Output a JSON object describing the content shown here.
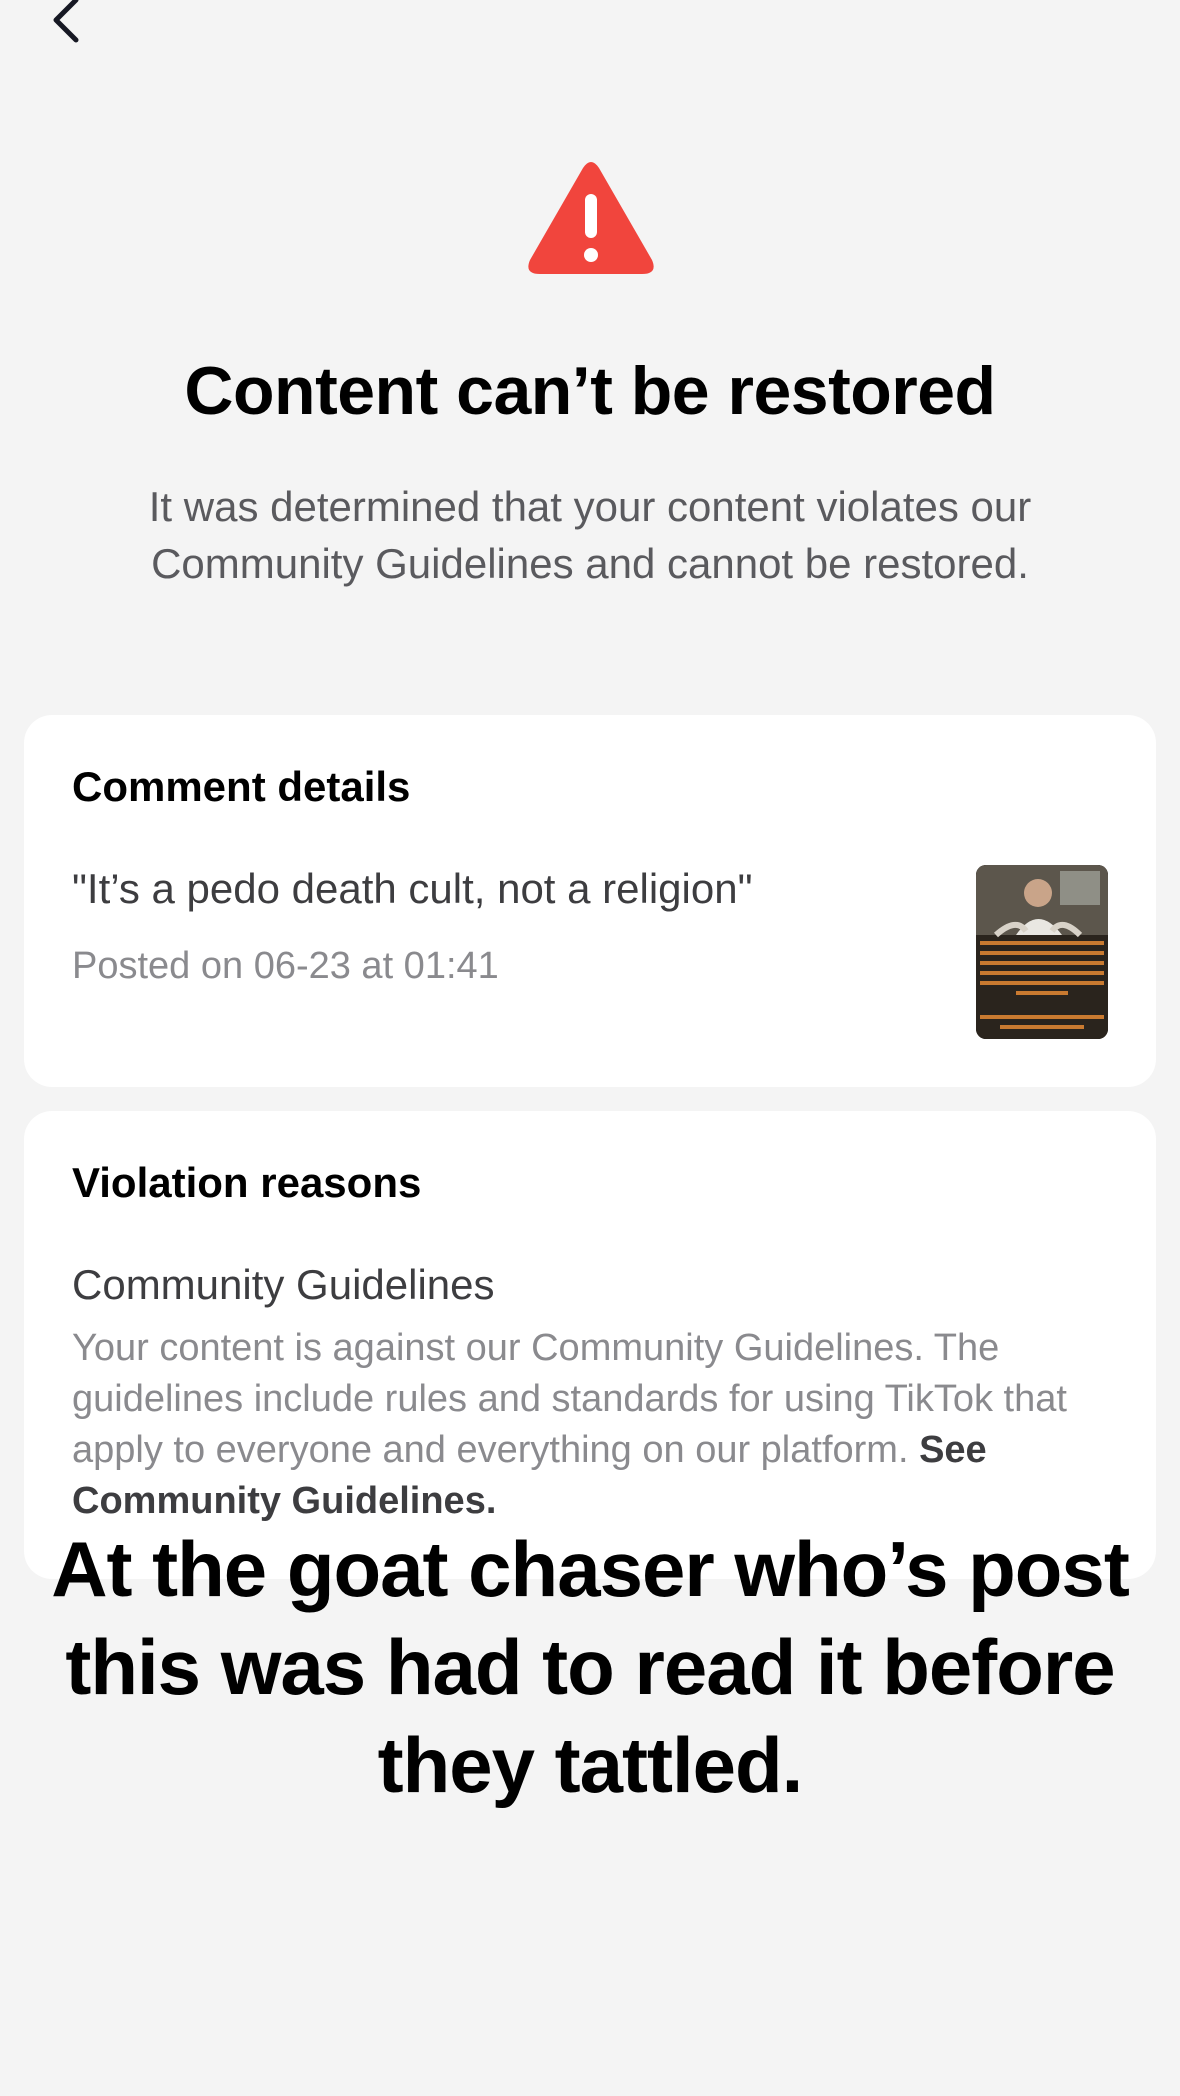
{
  "header": {
    "back_icon": "chevron-left-icon"
  },
  "status": {
    "icon": "warning-triangle-icon",
    "icon_color": "#f1453d",
    "title": "Content can’t be restored",
    "message": "It was determined that your content violates our Community Guidelines and cannot be restored."
  },
  "comment_card": {
    "heading": "Comment details",
    "comment_text": "\"It’s a pedo death cult, not a religion\"",
    "posted": "Posted on 06-23 at 01:41",
    "thumbnail": "video-thumbnail"
  },
  "violation_card": {
    "heading": "Violation reasons",
    "reason_title": "Community Guidelines",
    "reason_body": "Your content is against our Community Guidelines. The guidelines include rules and standards for using TikTok that apply to everyone and everything on our platform.",
    "link_label": "See Community Guidelines."
  },
  "overlay": {
    "caption": "At the goat chaser who’s post this was had to read it before they tattled."
  }
}
